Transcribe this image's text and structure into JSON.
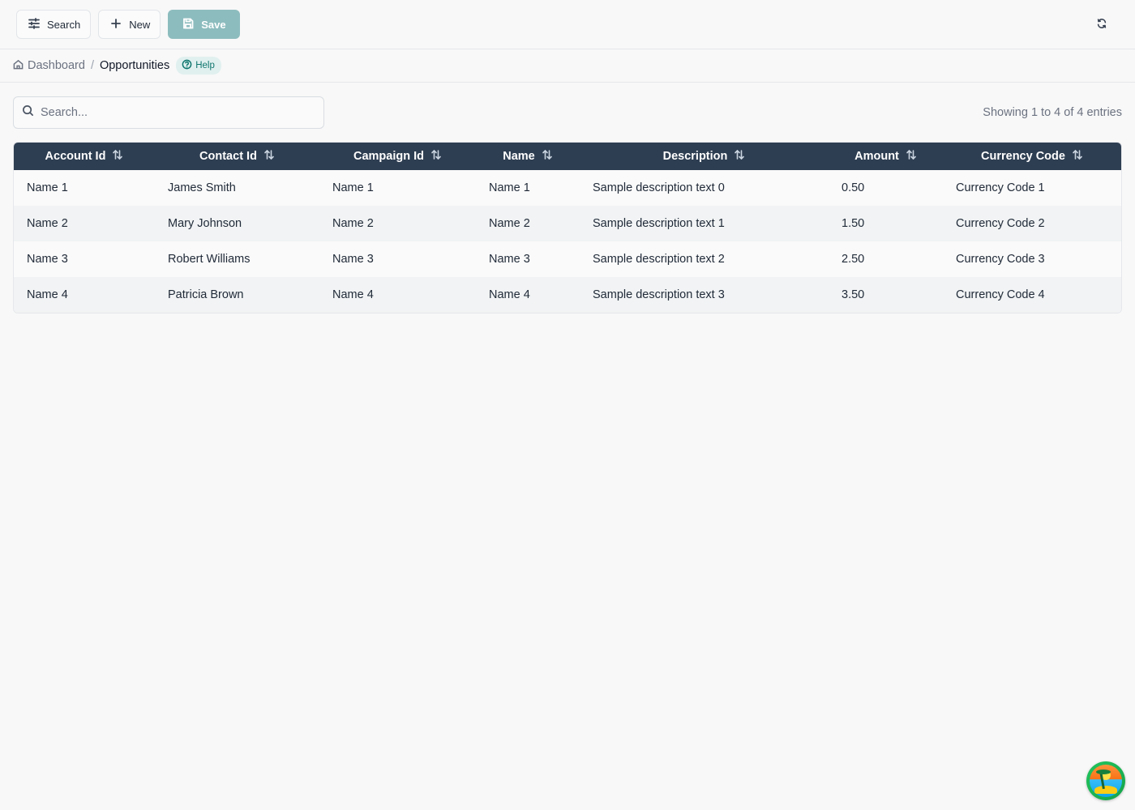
{
  "toolbar": {
    "search_label": "Search",
    "new_label": "New",
    "save_label": "Save"
  },
  "breadcrumb": {
    "home": "Dashboard",
    "separator": "/",
    "current": "Opportunities",
    "help": "Help"
  },
  "search": {
    "placeholder": "Search...",
    "value": ""
  },
  "entries_text": "Showing 1 to 4 of 4 entries",
  "table": {
    "columns": [
      "Account Id",
      "Contact Id",
      "Campaign Id",
      "Name",
      "Description",
      "Amount",
      "Currency Code"
    ],
    "rows": [
      [
        "Name 1",
        "James Smith",
        "Name 1",
        "Name 1",
        "Sample description text 0",
        "0.50",
        "Currency Code 1"
      ],
      [
        "Name 2",
        "Mary Johnson",
        "Name 2",
        "Name 2",
        "Sample description text 1",
        "1.50",
        "Currency Code 2"
      ],
      [
        "Name 3",
        "Robert Williams",
        "Name 3",
        "Name 3",
        "Sample description text 2",
        "2.50",
        "Currency Code 3"
      ],
      [
        "Name 4",
        "Patricia Brown",
        "Name 4",
        "Name 4",
        "Sample description text 3",
        "3.50",
        "Currency Code 4"
      ]
    ]
  },
  "colors": {
    "header_bg": "#2e3e52",
    "save_button": "#8dbcbe",
    "help_badge": "#e0f0ef"
  },
  "icons": {
    "search_button": "sliders-icon",
    "new_button": "plus-icon",
    "save_button": "floppy-disk-icon",
    "refresh": "refresh-icon",
    "home": "home-icon",
    "help": "question-circle-icon",
    "search_field": "search-icon",
    "sort": "sort-arrows-icon"
  }
}
